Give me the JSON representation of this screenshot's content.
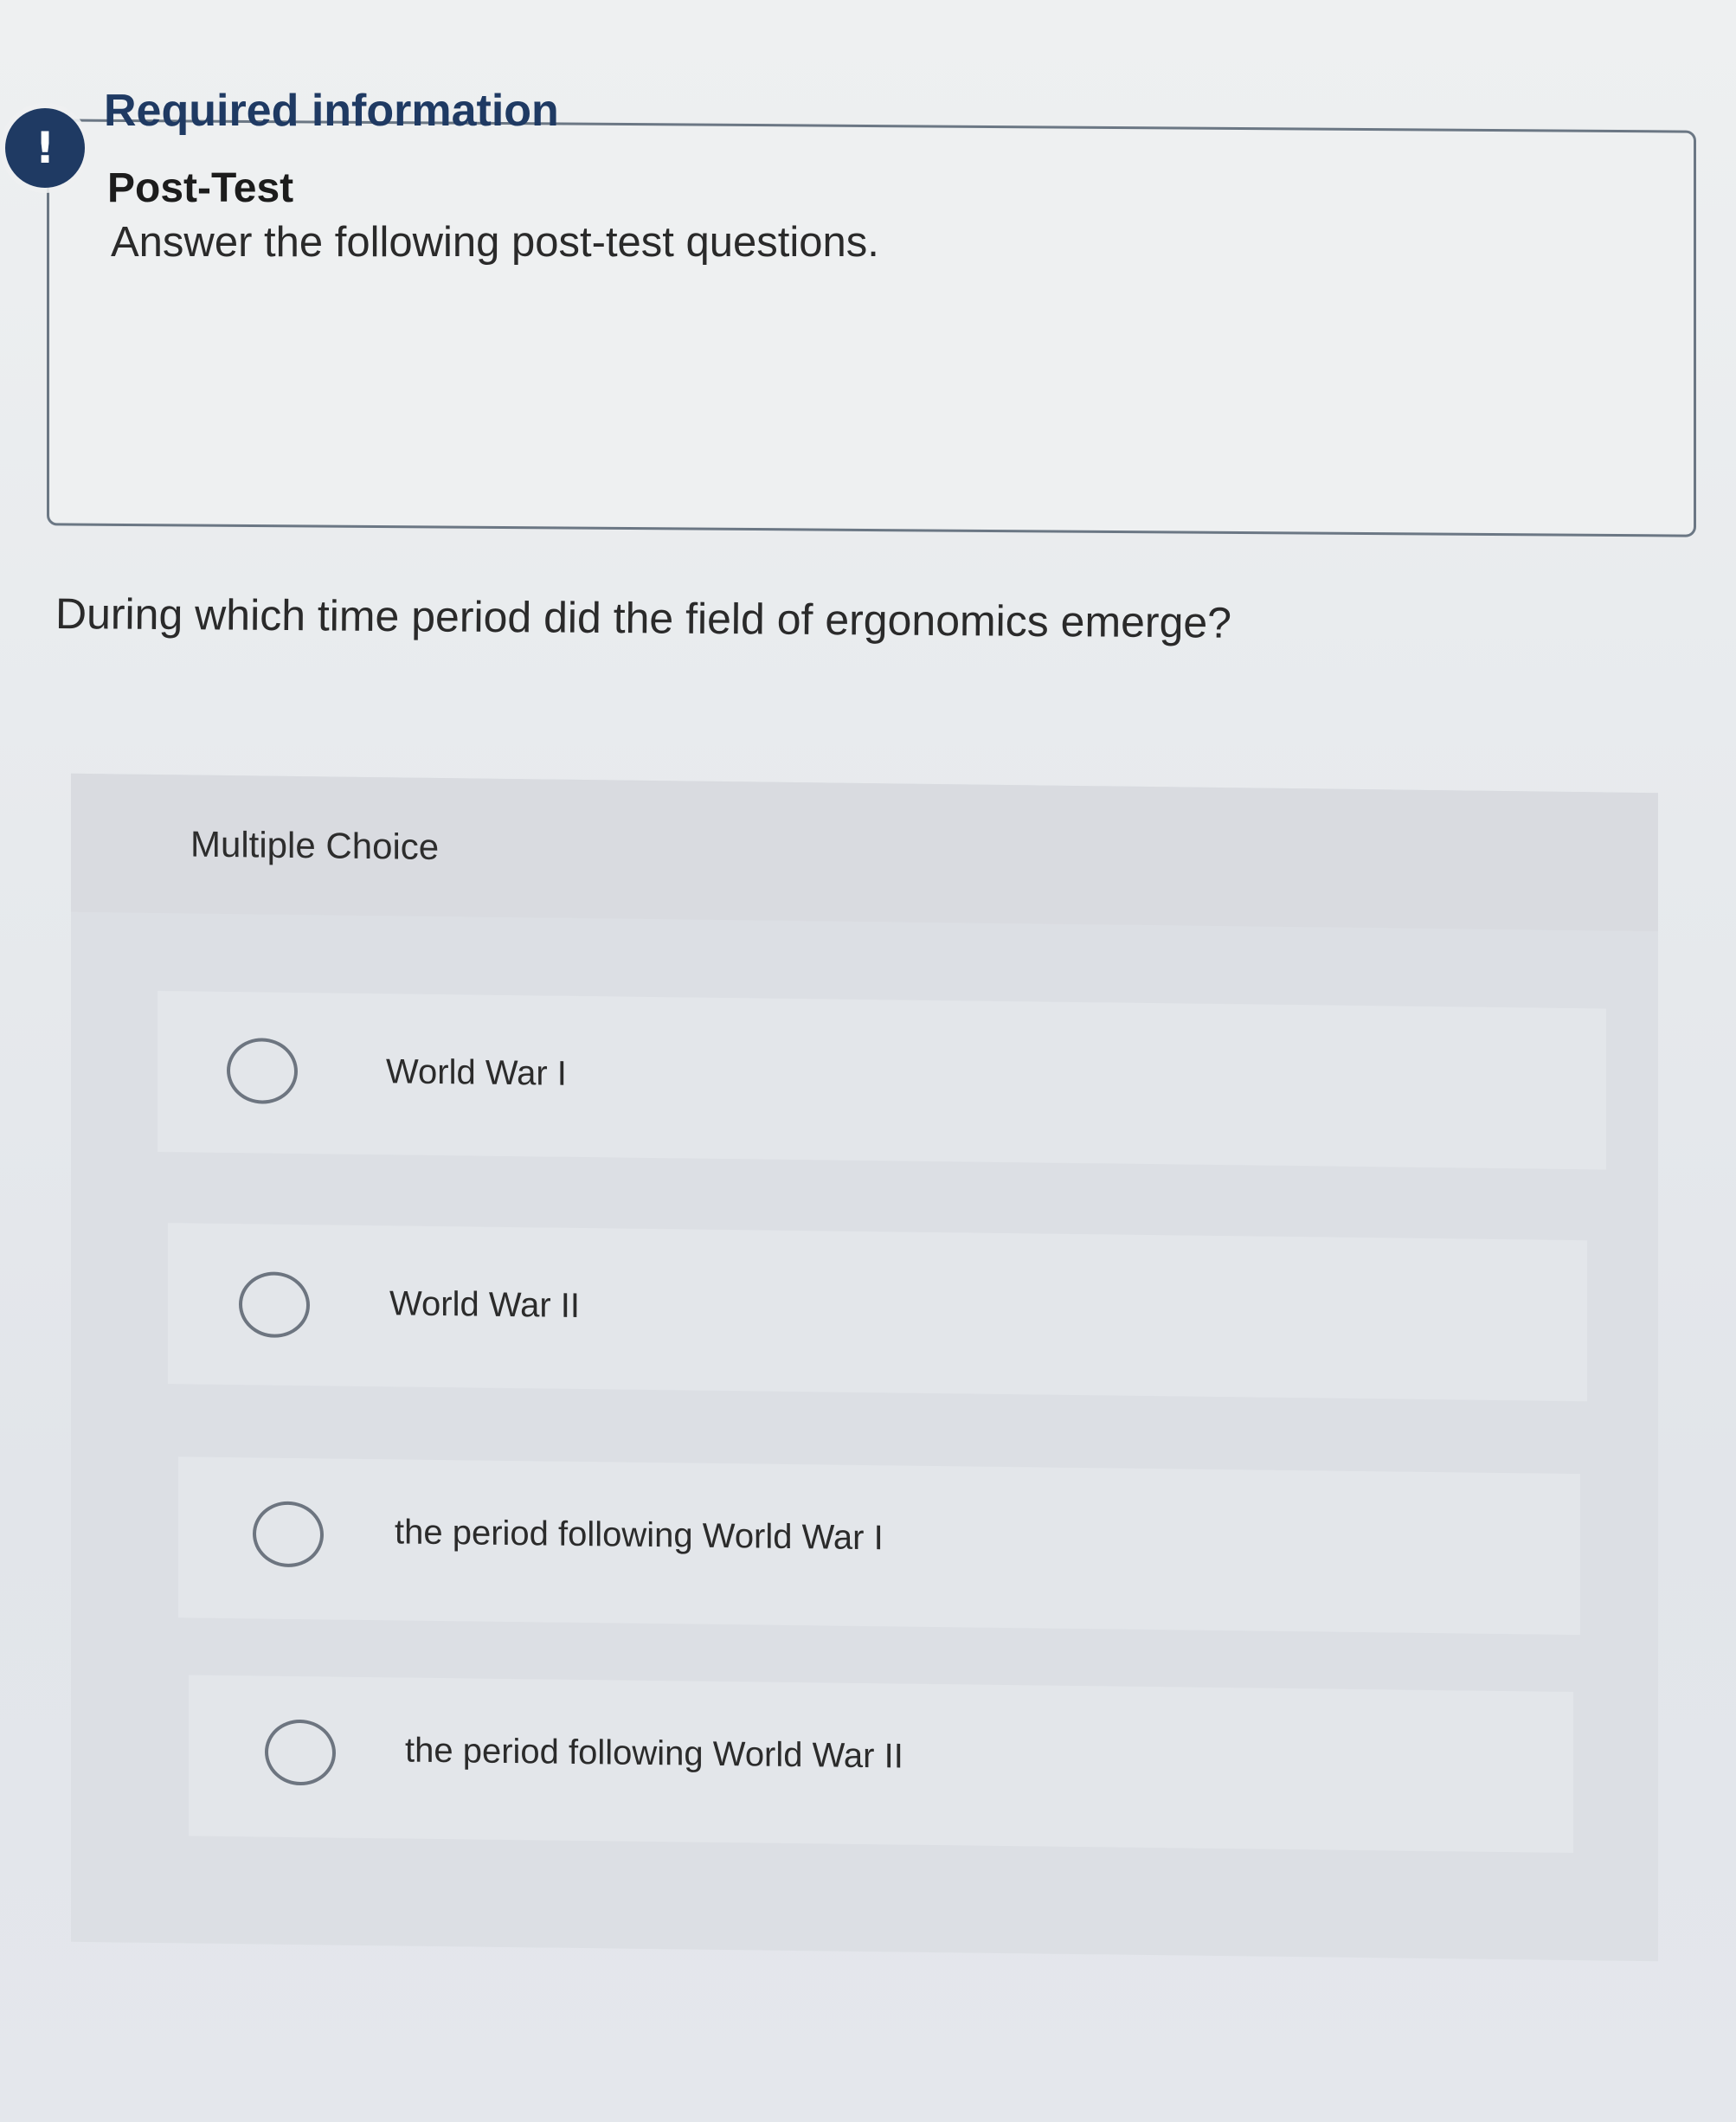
{
  "notice": {
    "badge_symbol": "!",
    "title": "Required information",
    "subtitle": "Post-Test",
    "text": "Answer the following post-test questions."
  },
  "question": {
    "text": "During which time period did the field of ergonomics emerge?"
  },
  "multiple_choice": {
    "label": "Multiple Choice",
    "options": [
      {
        "label": "World War I",
        "selected": false
      },
      {
        "label": "World War II",
        "selected": false
      },
      {
        "label": "the period following World War I",
        "selected": false
      },
      {
        "label": "the period following World War II",
        "selected": false
      }
    ]
  },
  "colors": {
    "accent": "#1f3a63",
    "background": "#eef0f1",
    "card": "#dcdfe4"
  }
}
